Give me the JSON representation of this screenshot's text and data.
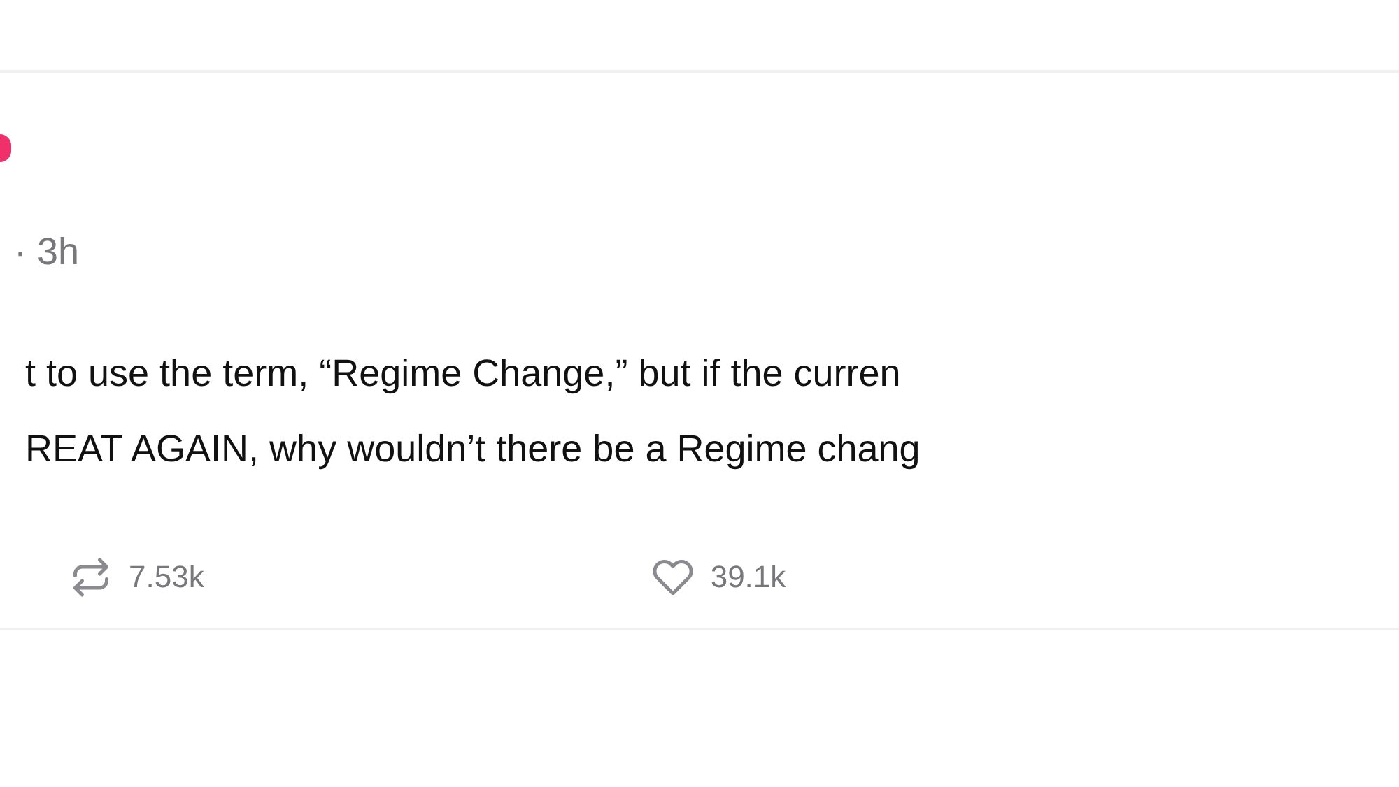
{
  "post": {
    "timestamp": "· 3h",
    "lines": [
      "t to use the term, “Regime Change,” but if the curren",
      "REAT AGAIN, why wouldn’t there be a Regime chang"
    ],
    "actions": [
      {
        "kind": "repost",
        "count": "7.53k"
      },
      {
        "kind": "like",
        "count": "39.1k"
      }
    ]
  }
}
